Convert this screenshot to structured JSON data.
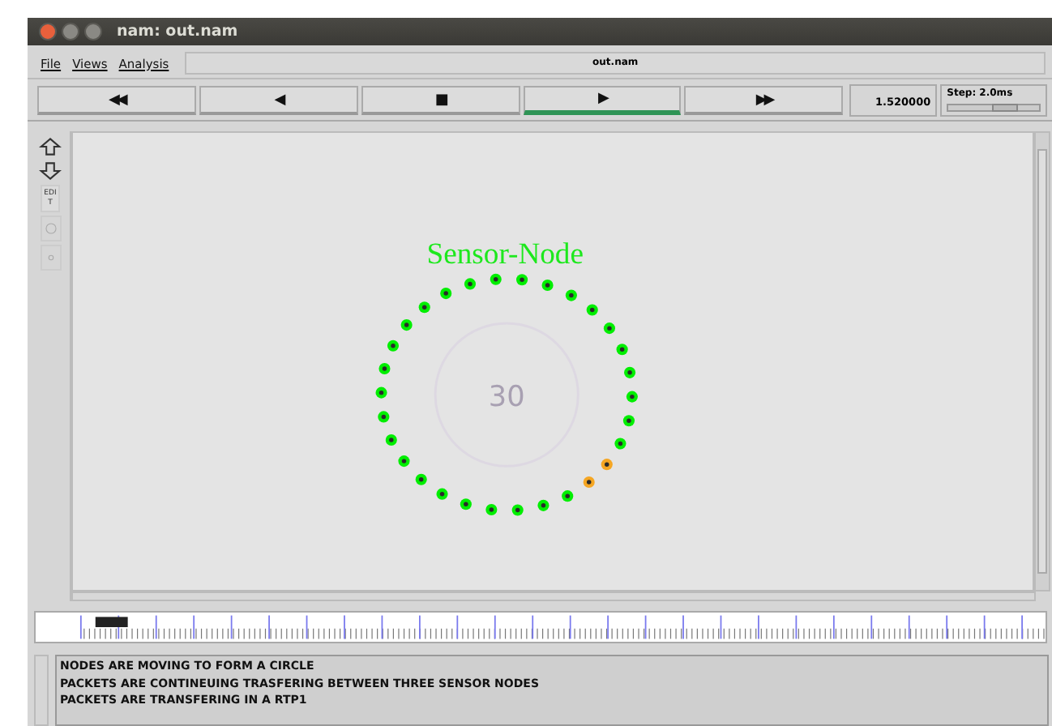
{
  "window": {
    "title": "nam: out.nam"
  },
  "menu": [
    "File",
    "Views",
    "Analysis"
  ],
  "file_name": "out.nam",
  "transport": [
    {
      "label": "◀◀",
      "selected": false
    },
    {
      "label": "◀",
      "selected": false
    },
    {
      "label": "■",
      "selected": false
    },
    {
      "label": "▶",
      "selected": true
    },
    {
      "label": "▶▶",
      "selected": false
    }
  ],
  "time": "1.520000",
  "step": {
    "label": "Step: 2.0ms",
    "level": 0.6
  },
  "tools": {
    "edit_label": "EDIT"
  },
  "canvas": {
    "title": "Sensor-Node",
    "center_label": "30",
    "nodes": [
      {
        "color": "#00ee00"
      },
      {
        "color": "#00ee00"
      },
      {
        "color": "#00ee00"
      },
      {
        "color": "#00ee00"
      },
      {
        "color": "#00ee00"
      },
      {
        "color": "#00ee00"
      },
      {
        "color": "#00ee00"
      },
      {
        "color": "#00ee00"
      },
      {
        "color": "#00ee00"
      },
      {
        "color": "#00ee00"
      },
      {
        "color": "#00ee00"
      },
      {
        "color": "#f5a623"
      },
      {
        "color": "#f5a623"
      },
      {
        "color": "#00ee00"
      },
      {
        "color": "#00ee00"
      },
      {
        "color": "#00ee00"
      },
      {
        "color": "#00ee00"
      },
      {
        "color": "#00ee00"
      },
      {
        "color": "#00ee00"
      },
      {
        "color": "#00ee00"
      },
      {
        "color": "#00ee00"
      },
      {
        "color": "#00ee00"
      },
      {
        "color": "#00ee00"
      },
      {
        "color": "#00ee00"
      },
      {
        "color": "#00ee00"
      },
      {
        "color": "#00ee00"
      },
      {
        "color": "#00ee00"
      },
      {
        "color": "#00ee00"
      },
      {
        "color": "#00ee00"
      },
      {
        "color": "#00ee00"
      }
    ]
  },
  "messages": [
    "NODES ARE MOVING TO FORM A CIRCLE",
    "PACKETS ARE CONTINEUING TRASFERING BETWEEN THREE SENSOR NODES",
    "PACKETS ARE TRANSFERING IN A RTP1"
  ]
}
